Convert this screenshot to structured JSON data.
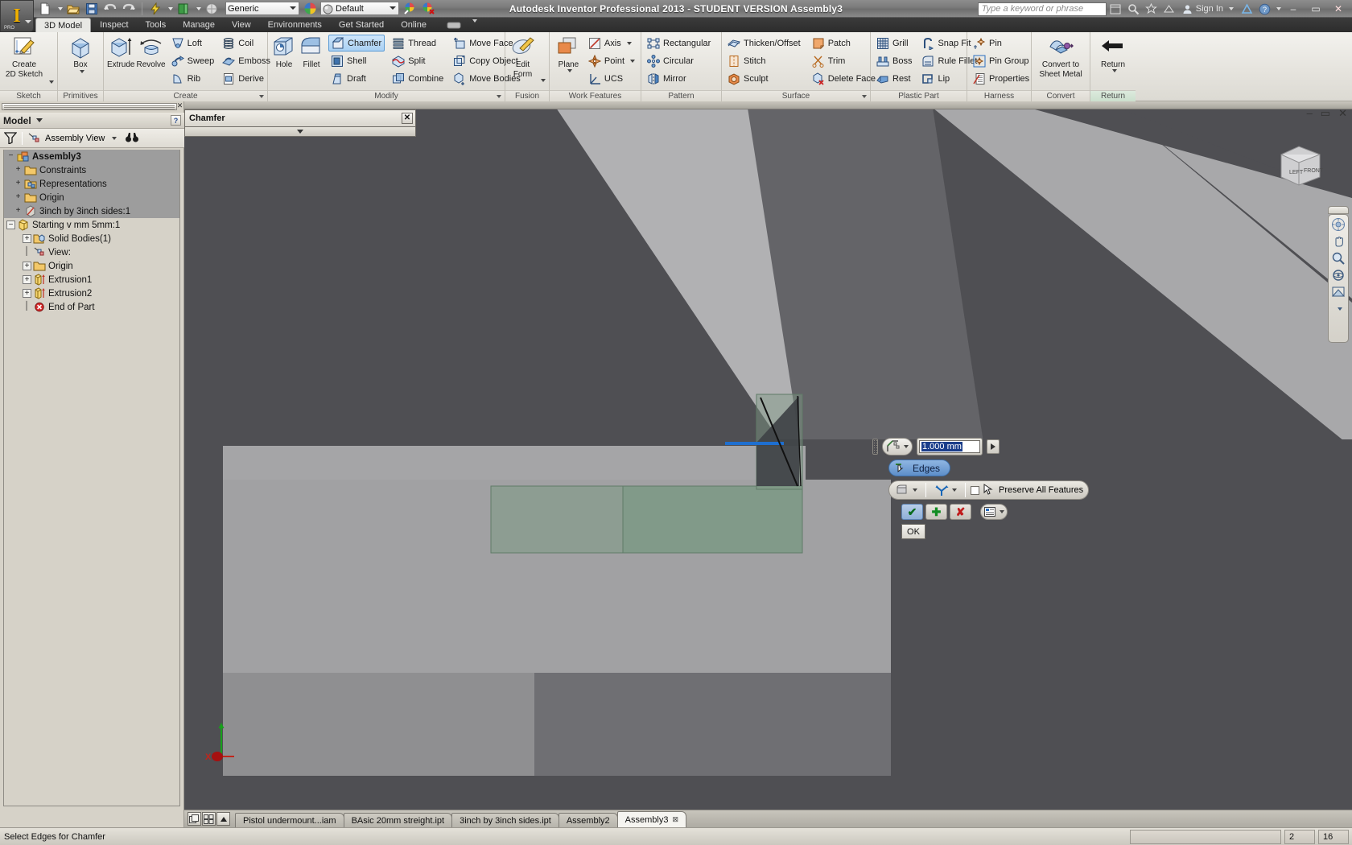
{
  "window": {
    "title": "Autodesk Inventor Professional 2013 - STUDENT VERSION    Assembly3",
    "minimize": "–",
    "maximize": "▭",
    "close": "✕"
  },
  "quick_access": {
    "material_value": "Generic",
    "appearance_value": "Default",
    "items": [
      {
        "name": "new-document-icon",
        "glyph": "🗋"
      },
      {
        "name": "open-document-icon",
        "glyph": "📂"
      },
      {
        "name": "save-icon",
        "glyph": "💾"
      },
      {
        "name": "undo-icon",
        "glyph": "↩"
      },
      {
        "name": "redo-icon",
        "glyph": "↪"
      },
      {
        "name": "update-icon",
        "glyph": "⚡"
      },
      {
        "name": "return-icon",
        "glyph": "▤"
      },
      {
        "name": "appearance-sphere-icon",
        "glyph": "◍"
      }
    ]
  },
  "search": {
    "placeholder": "Type a keyword or phrase"
  },
  "account": {
    "sign_in": "Sign In"
  },
  "ribbon": {
    "tabs": [
      {
        "label": "3D Model",
        "active": true
      },
      {
        "label": "Inspect",
        "active": false
      },
      {
        "label": "Tools",
        "active": false
      },
      {
        "label": "Manage",
        "active": false
      },
      {
        "label": "View",
        "active": false
      },
      {
        "label": "Environments",
        "active": false
      },
      {
        "label": "Get Started",
        "active": false
      },
      {
        "label": "Online",
        "active": false
      }
    ],
    "panels": {
      "sketch": {
        "title": "Sketch",
        "create_sketch_line1": "Create",
        "create_sketch_line2": "2D Sketch"
      },
      "primitives": {
        "title": "Primitives",
        "box": "Box"
      },
      "create": {
        "title": "Create",
        "extrude": "Extrude",
        "revolve": "Revolve",
        "loft": "Loft",
        "sweep": "Sweep",
        "rib": "Rib",
        "coil": "Coil",
        "emboss": "Emboss",
        "derive": "Derive"
      },
      "modify": {
        "title": "Modify",
        "hole": "Hole",
        "fillet": "Fillet",
        "chamfer": "Chamfer",
        "shell": "Shell",
        "draft": "Draft",
        "thread": "Thread",
        "split": "Split",
        "combine": "Combine",
        "move_face": "Move Face",
        "copy_object": "Copy Object",
        "move_bodies": "Move Bodies"
      },
      "fusion": {
        "title": "Fusion",
        "edit_form_line1": "Edit",
        "edit_form_line2": "Form"
      },
      "work_features": {
        "title": "Work Features",
        "plane": "Plane",
        "axis": "Axis",
        "point": "Point",
        "ucs": "UCS"
      },
      "pattern": {
        "title": "Pattern",
        "rectangular": "Rectangular",
        "circular": "Circular",
        "mirror": "Mirror"
      },
      "surface": {
        "title": "Surface",
        "thicken_offset": "Thicken/Offset",
        "stitch": "Stitch",
        "sculpt": "Sculpt",
        "patch": "Patch",
        "trim": "Trim",
        "delete_face": "Delete Face"
      },
      "plastic_part": {
        "title": "Plastic Part",
        "grill": "Grill",
        "boss": "Boss",
        "rest": "Rest",
        "snap_fit": "Snap Fit",
        "rule_fillet": "Rule Fillet",
        "lip": "Lip"
      },
      "harness": {
        "title": "Harness",
        "pin": "Pin",
        "pin_group": "Pin Group",
        "properties": "Properties"
      },
      "convert": {
        "title": "Convert",
        "convert_line1": "Convert to",
        "convert_line2": "Sheet Metal"
      },
      "return_panel": {
        "title": "Return",
        "return": "Return"
      }
    }
  },
  "browser": {
    "title": "Model",
    "help_glyph": "?",
    "view_mode": "Assembly View",
    "tree": [
      {
        "label": "Assembly3",
        "indent": 0,
        "expander": "minus-plain",
        "icon": "assembly-icon",
        "bold": true,
        "selected": true
      },
      {
        "label": "Constraints",
        "indent": 1,
        "expander": "plus-plain",
        "icon": "folder-icon",
        "bold": false,
        "selected": true
      },
      {
        "label": "Representations",
        "indent": 1,
        "expander": "plus-plain",
        "icon": "representations-icon",
        "bold": false,
        "selected": true
      },
      {
        "label": "Origin",
        "indent": 1,
        "expander": "plus-plain",
        "icon": "folder-icon",
        "bold": false,
        "selected": true
      },
      {
        "label": "3inch by 3inch sides:1",
        "indent": 1,
        "expander": "plus-plain",
        "icon": "part-grey-icon",
        "bold": false,
        "selected": true
      },
      {
        "label": "Starting v mm 5mm:1",
        "indent": 1,
        "expander": "minus-box",
        "icon": "part-yellow-icon",
        "bold": false,
        "selected": false
      },
      {
        "label": "Solid Bodies(1)",
        "indent": 2,
        "expander": "plus-box",
        "icon": "solid-bodies-icon",
        "bold": false,
        "selected": false
      },
      {
        "label": "View:",
        "indent": 2,
        "expander": "none",
        "icon": "view-icon",
        "bold": false,
        "selected": false
      },
      {
        "label": "Origin",
        "indent": 2,
        "expander": "plus-box",
        "icon": "folder-icon",
        "bold": false,
        "selected": false
      },
      {
        "label": "Extrusion1",
        "indent": 2,
        "expander": "plus-box",
        "icon": "extrusion-icon",
        "bold": false,
        "selected": false
      },
      {
        "label": "Extrusion2",
        "indent": 2,
        "expander": "plus-box",
        "icon": "extrusion-icon",
        "bold": false,
        "selected": false
      },
      {
        "label": "End of Part",
        "indent": 2,
        "expander": "none",
        "icon": "end-of-part-icon",
        "bold": false,
        "selected": false
      }
    ]
  },
  "chamfer_dialog": {
    "window_title": "Chamfer",
    "close_glyph": "✕",
    "distance_value": "1.000 mm",
    "edges_label": "Edges",
    "preserve_label": "Preserve All Features",
    "preserve_checked": false,
    "ok_label": "OK",
    "apply_glyph": "✔",
    "add_glyph": "✚",
    "cancel_glyph": "✘"
  },
  "viewcube": {
    "left_face": "LEFT",
    "front_face": "FRONT"
  },
  "navigation_bar": {
    "items": [
      {
        "name": "full-navigation-wheel-icon",
        "glyph": "◎"
      },
      {
        "name": "pan-icon",
        "glyph": "✋"
      },
      {
        "name": "zoom-icon",
        "glyph": "🔍"
      },
      {
        "name": "orbit-icon",
        "glyph": "⟳"
      },
      {
        "name": "look-at-icon",
        "glyph": "⊿"
      }
    ]
  },
  "triad": {
    "x_label": "X",
    "y_label": ""
  },
  "document_tabs": [
    {
      "label": "Pistol undermount...iam",
      "active": false,
      "closable": false
    },
    {
      "label": "BAsic 20mm streight.ipt",
      "active": false,
      "closable": false
    },
    {
      "label": "3inch by 3inch sides.ipt",
      "active": false,
      "closable": false
    },
    {
      "label": "Assembly2",
      "active": false,
      "closable": false
    },
    {
      "label": "Assembly3",
      "active": true,
      "closable": true,
      "close_glyph": "⊠"
    }
  ],
  "status_bar": {
    "message": "Select Edges for Chamfer",
    "counter_1": "2",
    "counter_2": "16"
  },
  "colors": {
    "ribbon_bg": "#e6e4de",
    "selection_blue": "#5d8ec9",
    "viewport_dark": "#4a4a4d",
    "viewport_mid": "#6f6f73",
    "viewport_light": "#a7a7a9",
    "preview_green": "#7e9a85",
    "highlight_edge": "#1e6fd0"
  }
}
